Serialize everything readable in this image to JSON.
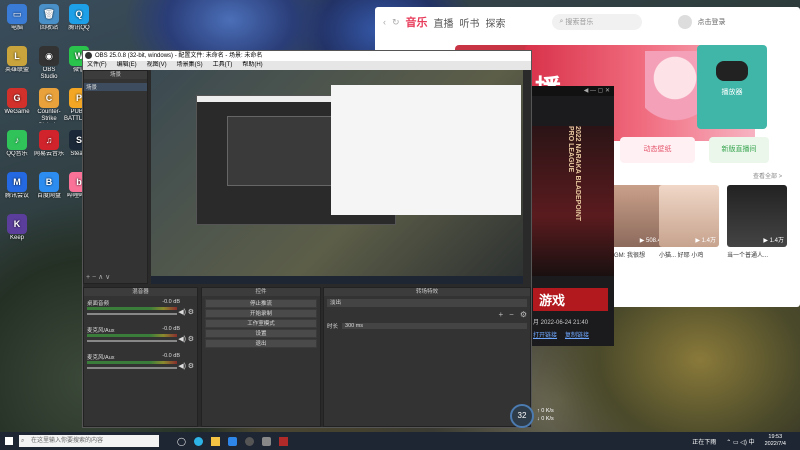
{
  "desktop_icons": [
    {
      "label": "电脑",
      "color": "#3a7bd5",
      "g": "▭"
    },
    {
      "label": "回收站",
      "color": "#4a90c8",
      "g": "🗑"
    },
    {
      "label": "腾讯QQ",
      "color": "#1da0e8",
      "g": "Q"
    },
    {
      "label": "英雄联盟",
      "color": "#c9a43c",
      "g": "L"
    },
    {
      "label": "OBS Studio",
      "color": "#333",
      "g": "◉"
    },
    {
      "label": "微信",
      "color": "#2ac34c",
      "g": "W"
    },
    {
      "label": "WeGame",
      "color": "#d2312b",
      "g": "G"
    },
    {
      "label": "Counter-Strike Global...",
      "color": "#e9a23b",
      "g": "C"
    },
    {
      "label": "PUBG BATTLEGR...",
      "color": "#f2a623",
      "g": "P"
    },
    {
      "label": "QQ音乐",
      "color": "#30c35a",
      "g": "♪"
    },
    {
      "label": "网易云音乐",
      "color": "#d0232b",
      "g": "♫"
    },
    {
      "label": "Steam",
      "color": "#1b2838",
      "g": "S"
    },
    {
      "label": "腾讯会议",
      "color": "#2469e1",
      "g": "M"
    },
    {
      "label": "百度网盘",
      "color": "#2d8cf0",
      "g": "B"
    },
    {
      "label": "哔哩哔哩",
      "color": "#fb7299",
      "g": "b"
    },
    {
      "label": "Keep",
      "color": "#5b3e9c",
      "g": "K"
    }
  ],
  "music": {
    "tabs": [
      "音乐",
      "直播",
      "听书",
      "探索"
    ],
    "search_placeholder": "搜索音乐",
    "user": "点击登录",
    "promo_big": "播",
    "promo_big2": "播放器",
    "card_btn1": "动态壁纸",
    "card_btn2": "新版直播间",
    "see_more": "查看全部 >",
    "videos": [
      {
        "cap": "▶ 508.4万",
        "title": "BGM: 我很想"
      },
      {
        "cap": "▶ 1.4万",
        "title": "小猫... 好耶 小鸡"
      },
      {
        "cap": "▶ 1.4万",
        "title": "当一个普通人..."
      }
    ]
  },
  "obs": {
    "title": "OBS 25.0.8 (32-bit, windows) - 配置文件: 未命名 - 场景: 未命名",
    "menu": [
      "文件(F)",
      "编辑(E)",
      "视图(V)",
      "场景集(S)",
      "工具(T)",
      "帮助(H)"
    ],
    "scenes_header": "场景",
    "sources_header": "来源",
    "scene_item": "场景",
    "mixer_header": "混音器",
    "transitions_header": "转场特效",
    "controls_header": "控件",
    "mixer": [
      {
        "name": "桌面音频",
        "db": "-0.0 dB"
      },
      {
        "name": "麦克风/Aux",
        "db": "-0.0 dB"
      },
      {
        "name": "麦克风/Aux",
        "db": "-0.0 dB"
      }
    ],
    "controls": [
      "停止推流",
      "开始录制",
      "工作室模式",
      "设置",
      "退出"
    ],
    "transition_name": "淡出",
    "duration_label": "时长",
    "duration_value": "300 ms"
  },
  "promo": {
    "year_text": "2022 NARAKA BLADEPOINT PRO LEAGUE",
    "game": "游戏",
    "date": "月 2022-06-24 21:40",
    "link1": "打开链接",
    "link2": "复制链接"
  },
  "taskbar": {
    "search_placeholder": "在这里输入你要搜索的内容",
    "weather": "正在下雨",
    "time": "19:53",
    "date": "2022/7/4"
  },
  "overlay": {
    "fps": "32",
    "up": "↑ 0 K/s",
    "down": "↓ 0 K/s"
  }
}
